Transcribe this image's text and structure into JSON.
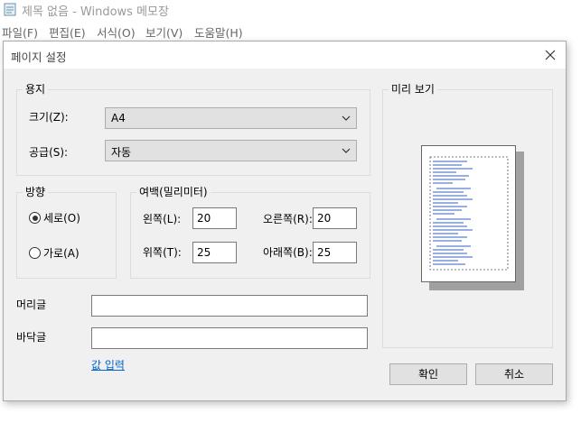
{
  "notepad": {
    "title": "제목 없음 - Windows 메모장",
    "menu": [
      "파일(F)",
      "편집(E)",
      "서식(O)",
      "보기(V)",
      "도움말(H)"
    ]
  },
  "dialog": {
    "title": "페이지 설정",
    "paper": {
      "group_label": "용지",
      "size_label": "크기(Z):",
      "size_value": "A4",
      "source_label": "공급(S):",
      "source_value": "자동"
    },
    "orientation": {
      "group_label": "방향",
      "portrait_label": "세로(O)",
      "landscape_label": "가로(A)",
      "selected": "portrait"
    },
    "margins": {
      "group_label": "여백(밀리미터)",
      "left_label": "왼쪽(L):",
      "left_value": "20",
      "right_label": "오른쪽(R):",
      "right_value": "20",
      "top_label": "위쪽(T):",
      "top_value": "25",
      "bottom_label": "아래쪽(B):",
      "bottom_value": "25"
    },
    "header_label": "머리글",
    "header_value": "",
    "footer_label": "바닥글",
    "footer_value": "",
    "input_values_link": "값 입력",
    "preview_label": "미리 보기",
    "ok_button": "확인",
    "cancel_button": "취소"
  },
  "colors": {
    "dialog_bg": "#f0f0f0",
    "link": "#0066cc",
    "button_bg": "#e1e1e1"
  }
}
